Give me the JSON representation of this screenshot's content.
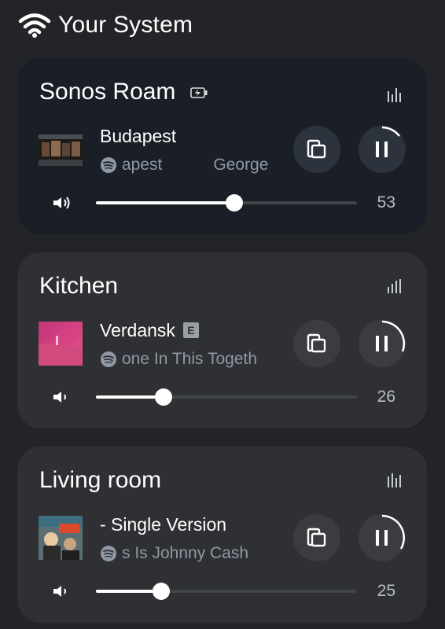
{
  "header": {
    "title": "Your System",
    "icon": "wifi-icon"
  },
  "rooms": [
    {
      "name": "Sonos Roam",
      "track": "Budapest",
      "subtitle_left": "apest",
      "subtitle_right": "George",
      "volume": "53",
      "volume_level": 0.53,
      "explicit": false,
      "battery_icon": "battery-charging-icon",
      "active": true
    },
    {
      "name": "Kitchen",
      "track": "Verdansk",
      "explicit_label": "E",
      "subtitle": "one In This Togeth",
      "volume": "26",
      "volume_level": 0.26,
      "active": false
    },
    {
      "name": "Living room",
      "track": "- Single Version",
      "subtitle": "s Is Johnny Cash",
      "volume": "25",
      "volume_level": 0.25,
      "active": false
    }
  ],
  "colors": {
    "background": "#232427",
    "card": "#2f3033",
    "active_card": "#1a1f27",
    "muted_text": "#8f98a6"
  }
}
